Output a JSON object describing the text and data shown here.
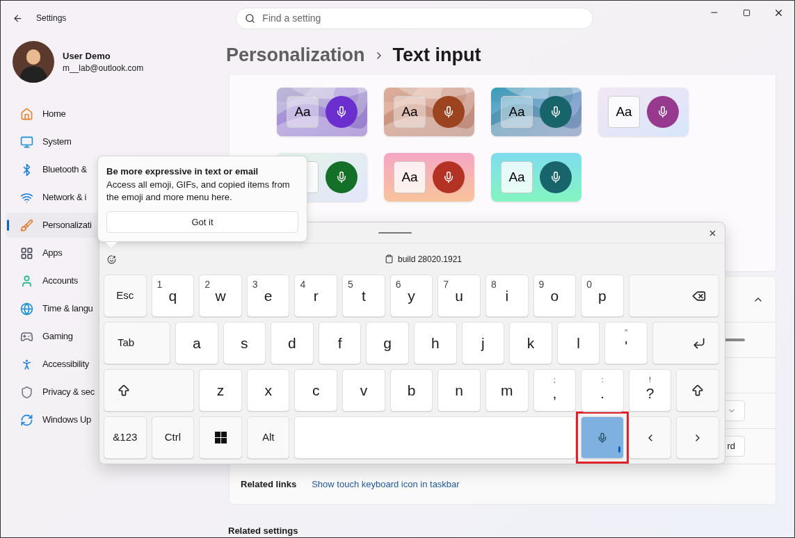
{
  "window": {
    "title": "Settings"
  },
  "search": {
    "placeholder": "Find a setting"
  },
  "user": {
    "name": "User Demo",
    "email": "m__lab@outlook.com"
  },
  "sidebar": {
    "items": [
      {
        "label": "Home",
        "selected": false
      },
      {
        "label": "System",
        "selected": false
      },
      {
        "label": "Bluetooth &",
        "selected": false
      },
      {
        "label": "Network & i",
        "selected": false
      },
      {
        "label": "Personalizati",
        "selected": true
      },
      {
        "label": "Apps",
        "selected": false
      },
      {
        "label": "Accounts",
        "selected": false
      },
      {
        "label": "Time & langu",
        "selected": false
      },
      {
        "label": "Gaming",
        "selected": false
      },
      {
        "label": "Accessibility",
        "selected": false
      },
      {
        "label": "Privacy & sec",
        "selected": false
      },
      {
        "label": "Windows Up",
        "selected": false
      }
    ]
  },
  "breadcrumb": {
    "parent": "Personalization",
    "current": "Text input"
  },
  "themes": [
    {
      "label": "Aa",
      "color": "#6b2fcf"
    },
    {
      "label": "Aa",
      "color": "#9c4320"
    },
    {
      "label": "Aa",
      "color": "#17646a"
    },
    {
      "kind": "gradient",
      "label": "Aa",
      "color": "#973a8f"
    },
    {
      "kind": "gradient",
      "color": "#157027"
    },
    {
      "kind": "gradient",
      "label": "Aa",
      "color": "#b43224"
    },
    {
      "kind": "gradient",
      "label": "Aa",
      "color": "#17646a"
    }
  ],
  "settings_card": {
    "rows": [
      {
        "kind": "expander",
        "expanded": true
      },
      {
        "kind": "slider"
      },
      {
        "kind": "blank"
      },
      {
        "kind": "dropdown"
      },
      {
        "kind": "button",
        "label": "rd"
      }
    ]
  },
  "related_links": {
    "label": "Related links",
    "link": "Show touch keyboard icon in taskbar"
  },
  "related_settings": {
    "heading": "Related settings"
  },
  "tooltip": {
    "title": "Be more expressive in text or email",
    "body": "Access all emoji, GIFs, and copied items from the emoji and more menu here.",
    "button": "Got it"
  },
  "keyboard": {
    "build": "build 28020.1921",
    "rows": [
      {
        "keys": [
          {
            "kind": "function",
            "label": "Esc"
          },
          {
            "kind": "letter",
            "label": "q",
            "hint": "1"
          },
          {
            "kind": "letter",
            "label": "w",
            "hint": "2"
          },
          {
            "kind": "letter",
            "label": "e",
            "hint": "3"
          },
          {
            "kind": "letter",
            "label": "r",
            "hint": "4"
          },
          {
            "kind": "letter",
            "label": "t",
            "hint": "5"
          },
          {
            "kind": "letter",
            "label": "y",
            "hint": "6"
          },
          {
            "kind": "letter",
            "label": "u",
            "hint": "7"
          },
          {
            "kind": "letter",
            "label": "i",
            "hint": "8"
          },
          {
            "kind": "letter",
            "label": "o",
            "hint": "9"
          },
          {
            "kind": "letter",
            "label": "p",
            "hint": "0"
          },
          {
            "kind": "backspace"
          }
        ]
      },
      {
        "keys": [
          {
            "kind": "tab",
            "label": "Tab"
          },
          {
            "kind": "letter",
            "label": "a"
          },
          {
            "kind": "letter",
            "label": "s"
          },
          {
            "kind": "letter",
            "label": "d"
          },
          {
            "kind": "letter",
            "label": "f"
          },
          {
            "kind": "letter",
            "label": "g"
          },
          {
            "kind": "letter",
            "label": "h"
          },
          {
            "kind": "letter",
            "label": "j"
          },
          {
            "kind": "letter",
            "label": "k"
          },
          {
            "kind": "letter",
            "label": "l"
          },
          {
            "kind": "symbol",
            "label": "'",
            "hint": "\""
          },
          {
            "kind": "enter"
          }
        ]
      },
      {
        "keys": [
          {
            "kind": "shift-wide"
          },
          {
            "kind": "letter",
            "label": "z"
          },
          {
            "kind": "letter",
            "label": "x"
          },
          {
            "kind": "letter",
            "label": "c"
          },
          {
            "kind": "letter",
            "label": "v"
          },
          {
            "kind": "letter",
            "label": "b"
          },
          {
            "kind": "letter",
            "label": "n"
          },
          {
            "kind": "letter",
            "label": "m"
          },
          {
            "kind": "symbol",
            "label": ",",
            "hint": ";"
          },
          {
            "kind": "symbol",
            "label": ".",
            "hint": ":"
          },
          {
            "kind": "symbol",
            "label": "?",
            "hint": "!"
          },
          {
            "kind": "shift"
          }
        ]
      },
      {
        "keys": [
          {
            "kind": "function",
            "label": "&123"
          },
          {
            "kind": "function",
            "label": "Ctrl"
          },
          {
            "kind": "windows"
          },
          {
            "kind": "function",
            "label": "Alt"
          },
          {
            "kind": "space"
          },
          {
            "kind": "mic",
            "selected": true,
            "annotated": true
          },
          {
            "kind": "left"
          },
          {
            "kind": "right"
          }
        ]
      }
    ]
  }
}
